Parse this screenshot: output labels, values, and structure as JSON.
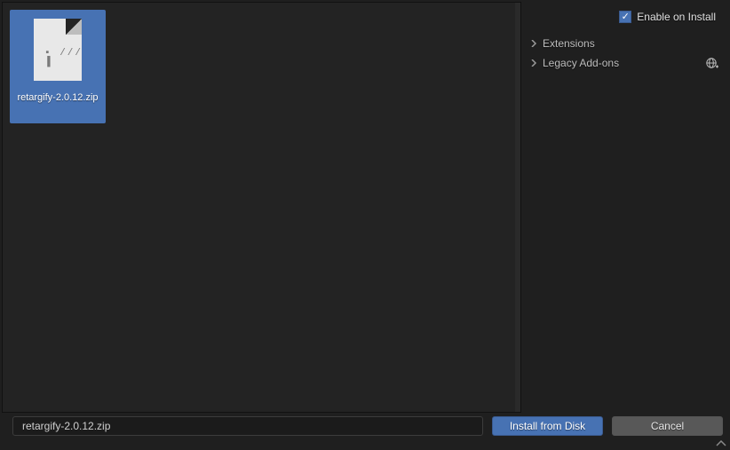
{
  "file_browser": {
    "items": [
      {
        "name": "retargify-2.0.12.zip",
        "selected": true
      }
    ]
  },
  "sidebar": {
    "enable_on_install_label": "Enable on Install",
    "enable_on_install_checked": true,
    "tree": [
      {
        "label": "Extensions"
      },
      {
        "label": "Legacy Add-ons",
        "has_globe": true
      }
    ]
  },
  "footer": {
    "filename_value": "retargify-2.0.12.zip",
    "install_label": "Install from Disk",
    "cancel_label": "Cancel"
  }
}
